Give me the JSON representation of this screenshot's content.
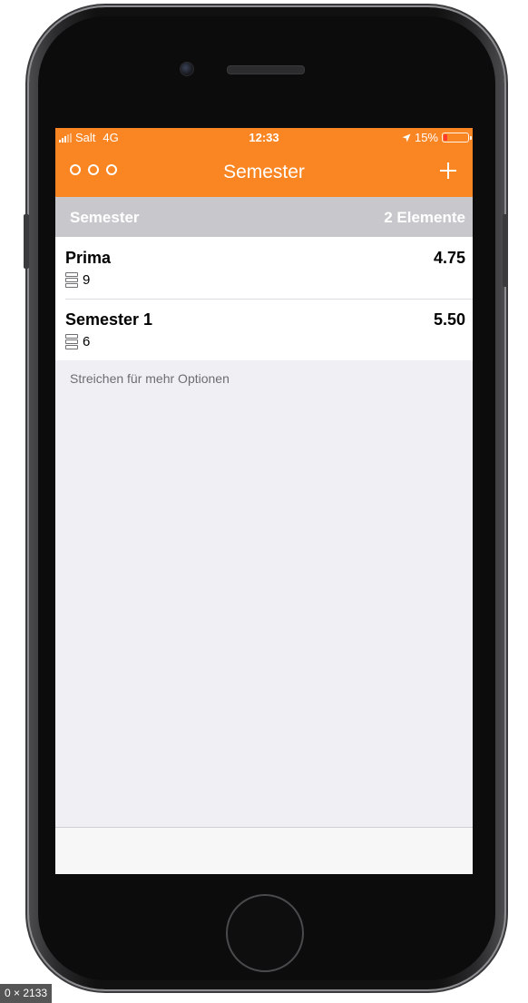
{
  "status_bar": {
    "carrier": "Salt",
    "network": "4G",
    "time": "12:33",
    "battery": "15%",
    "battery_level": 0.15,
    "battery_color": "#ff3b30",
    "location_icon": "location-arrow-icon"
  },
  "nav_bar": {
    "title": "Semester",
    "more_icon": "more-dots-icon",
    "add_icon": "plus-icon",
    "color": "#f98523"
  },
  "section": {
    "title": "Semester",
    "count": "2 Elemente"
  },
  "semesters": [
    {
      "name": "Prima",
      "count": "9",
      "grade": "4.75",
      "icon": "list-icon"
    },
    {
      "name": "Semester 1",
      "count": "6",
      "grade": "5.50",
      "icon": "list-icon"
    }
  ],
  "hint": "Streichen für mehr Optionen",
  "image_caption": "0 × 2133"
}
